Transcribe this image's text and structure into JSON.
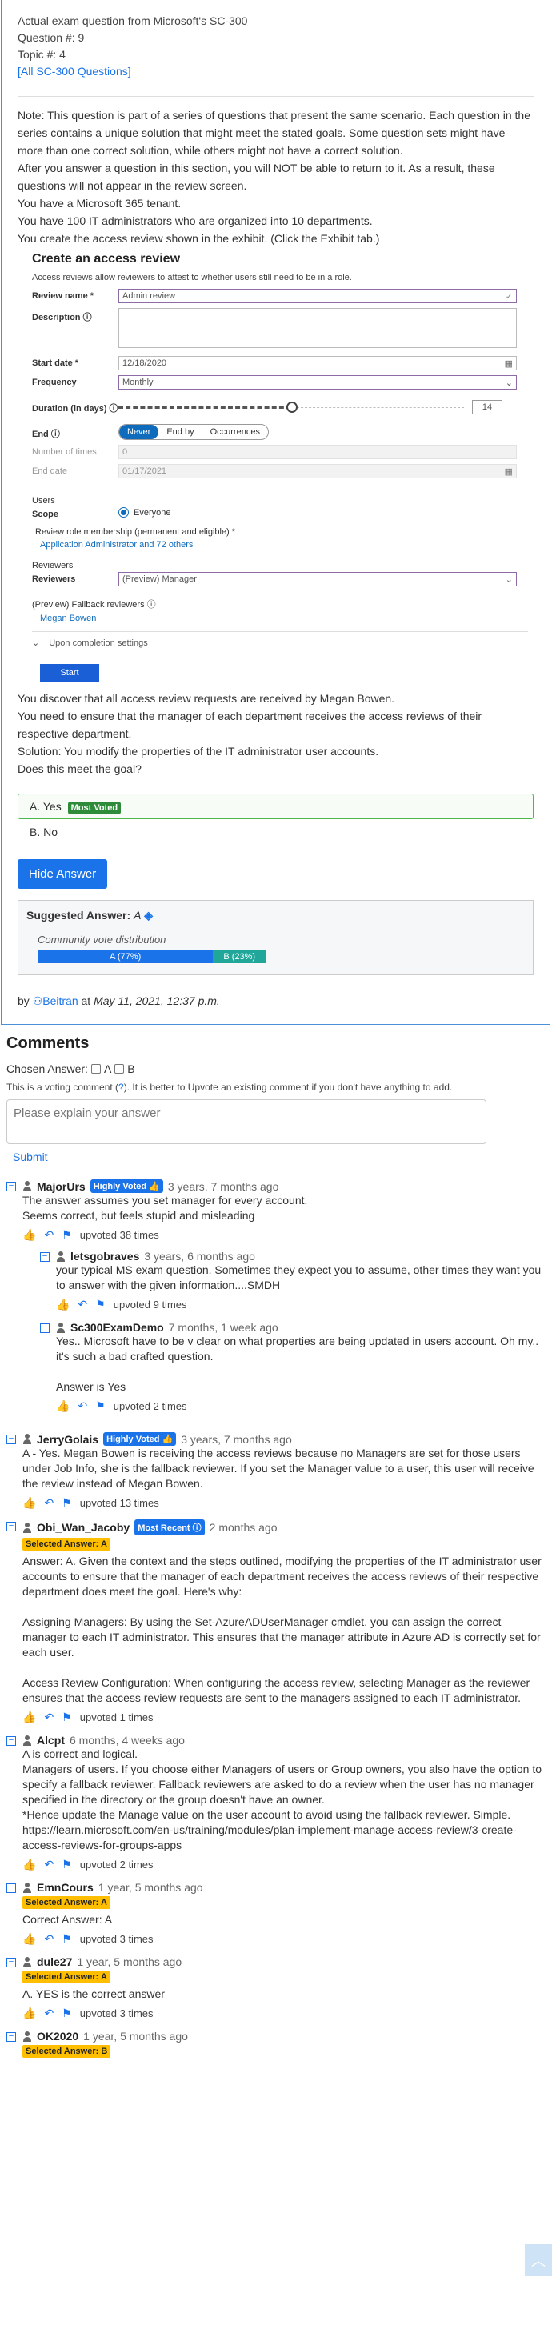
{
  "header": {
    "title": "Actual exam question from Microsoft's SC-300",
    "question_number": "Question #: 9",
    "topic": "Topic #: 4",
    "all_questions_link": "[All SC-300 Questions]"
  },
  "question": {
    "paragraphs": [
      "Note: This question is part of a series of questions that present the same scenario. Each question in the series contains a unique solution that might meet the stated goals. Some question sets might have more than one correct solution, while others might not have a correct solution.",
      "After you answer a question in this section, you will NOT be able to return to it. As a result, these questions will not appear in the review screen.",
      "You have a Microsoft 365 tenant.",
      "You have 100 IT administrators who are organized into 10 departments.",
      "You create the access review shown in the exhibit. (Click the Exhibit tab.)"
    ],
    "after_paragraphs": [
      "You discover that all access review requests are received by Megan Bowen.",
      "You need to ensure that the manager of each department receives the access reviews of their respective department.",
      "Solution: You modify the properties of the IT administrator user accounts.",
      "Does this meet the goal?"
    ]
  },
  "exhibit": {
    "title": "Create an access review",
    "subtitle": "Access reviews allow reviewers to attest to whether users still need to be in a role.",
    "review_name_label": "Review name *",
    "review_name_value": "Admin review",
    "description_label": "Description ⓘ",
    "start_date_label": "Start date *",
    "start_date_value": "12/18/2020",
    "frequency_label": "Frequency",
    "frequency_value": "Monthly",
    "duration_label": "Duration (in days) ⓘ",
    "duration_value": "14",
    "duration_fraction": 0.5,
    "end_label": "End ⓘ",
    "end_options": [
      "Never",
      "End by",
      "Occurrences"
    ],
    "number_of_times_label": "Number of times",
    "number_of_times_value": "0",
    "end_date_label": "End date",
    "end_date_value": "01/17/2021",
    "users_heading": "Users",
    "scope_label": "Scope",
    "scope_value": "Everyone",
    "membership_label": "Review role membership (permanent and eligible) *",
    "membership_value": "Application Administrator and 72 others",
    "reviewers_heading": "Reviewers",
    "reviewers_label": "Reviewers",
    "reviewers_value": "(Preview) Manager",
    "fallback_label": "(Preview) Fallback reviewers ⓘ",
    "fallback_value": "Megan Bowen",
    "completion_label": "Upon completion settings",
    "start_button": "Start"
  },
  "answers": {
    "a_label": "A. Yes",
    "a_badge": "Most Voted",
    "b_label": "B. No",
    "hide_button": "Hide Answer",
    "suggested_label": "Suggested Answer:",
    "suggested_value": "A",
    "community_label": "Community vote distribution",
    "vote_a": "A (77%)",
    "vote_b": "B (23%)",
    "vote_a_fraction": 0.77,
    "byline_prefix": "by",
    "byline_user": "Beitran",
    "byline_at": "at",
    "byline_date": "May 11, 2021, 12:37 p.m."
  },
  "comments_section": {
    "heading": "Comments",
    "chosen_answer_label": "Chosen Answer:",
    "option_a": "A",
    "option_b": "B",
    "voting_note_prefix": "This is a voting comment (",
    "voting_note_link": "?",
    "voting_note_suffix": "). It is better to Upvote an existing comment if you don't have anything to add.",
    "textarea_placeholder": "Please explain your answer",
    "submit": "Submit"
  },
  "comments": [
    {
      "user": "MajorUrs",
      "badge": "Highly Voted 👍",
      "time": "3 years, 7 months ago",
      "selected": "",
      "text": [
        "The answer assumes you set manager for every account.",
        "Seems correct, but feels stupid and misleading"
      ],
      "upvotes": "upvoted 38 times",
      "replies": [
        {
          "user": "letsgobraves",
          "badge": "",
          "time": "3 years, 6 months ago",
          "selected": "",
          "text": [
            "your typical MS exam question. Sometimes they expect you to assume, other times they want you to answer with the given information....SMDH"
          ],
          "upvotes": "upvoted 9 times"
        },
        {
          "user": "Sc300ExamDemo",
          "badge": "",
          "time": "7 months, 1 week ago",
          "selected": "",
          "text": [
            "Yes.. Microsoft have to be v clear on what properties are being updated in users account. Oh my.. it's such a bad crafted question.",
            "",
            "Answer is Yes"
          ],
          "upvotes": "upvoted 2 times"
        }
      ]
    },
    {
      "user": "JerryGolais",
      "badge": "Highly Voted 👍",
      "time": "3 years, 7 months ago",
      "selected": "",
      "text": [
        "A - Yes. Megan Bowen is receiving the access reviews because no Managers are set for those users under Job Info, she is the fallback reviewer. If you set the Manager value to a user, this user will receive the review instead of Megan Bowen."
      ],
      "upvotes": "upvoted 13 times",
      "replies": []
    },
    {
      "user": "Obi_Wan_Jacoby",
      "badge": "Most Recent ⓘ",
      "time": "2 months ago",
      "selected": "Selected Answer: A",
      "text": [
        "Answer: A. Given the context and the steps outlined, modifying the properties of the IT administrator user accounts to ensure that the manager of each department receives the access reviews of their respective department does meet the goal. Here's why:",
        "",
        "Assigning Managers: By using the Set-AzureADUserManager cmdlet, you can assign the correct manager to each IT administrator. This ensures that the manager attribute in Azure AD is correctly set for each user.",
        "",
        "Access Review Configuration: When configuring the access review, selecting Manager as the reviewer ensures that the access review requests are sent to the managers assigned to each IT administrator."
      ],
      "upvotes": "upvoted 1 times",
      "replies": []
    },
    {
      "user": "Alcpt",
      "badge": "",
      "time": "6 months, 4 weeks ago",
      "selected": "",
      "text": [
        "A is correct and logical.",
        "Managers of users. If you choose either Managers of users or Group owners, you also have the option to specify a fallback reviewer. Fallback reviewers are asked to do a review when the user has no manager specified in the directory or the group doesn't have an owner.",
        "*Hence update the Manage value on the user account to avoid using the fallback reviewer. Simple.",
        "https://learn.microsoft.com/en-us/training/modules/plan-implement-manage-access-review/3-create-access-reviews-for-groups-apps"
      ],
      "upvotes": "upvoted 2 times",
      "replies": []
    },
    {
      "user": "EmnCours",
      "badge": "",
      "time": "1 year, 5 months ago",
      "selected": "Selected Answer: A",
      "text": [
        "Correct Answer: A"
      ],
      "upvotes": "upvoted 3 times",
      "replies": []
    },
    {
      "user": "dule27",
      "badge": "",
      "time": "1 year, 5 months ago",
      "selected": "Selected Answer: A",
      "text": [
        "A. YES is the correct answer"
      ],
      "upvotes": "upvoted 3 times",
      "replies": []
    },
    {
      "user": "OK2020",
      "badge": "",
      "time": "1 year, 5 months ago",
      "selected": "Selected Answer: B",
      "text": [],
      "upvotes": "",
      "replies": []
    }
  ],
  "colors": {
    "link": "#1a73e8",
    "correct_border": "#4cb84c",
    "vote_a": "#1a73e8",
    "vote_b": "#21a79a",
    "selected_badge": "#ffbf00"
  }
}
